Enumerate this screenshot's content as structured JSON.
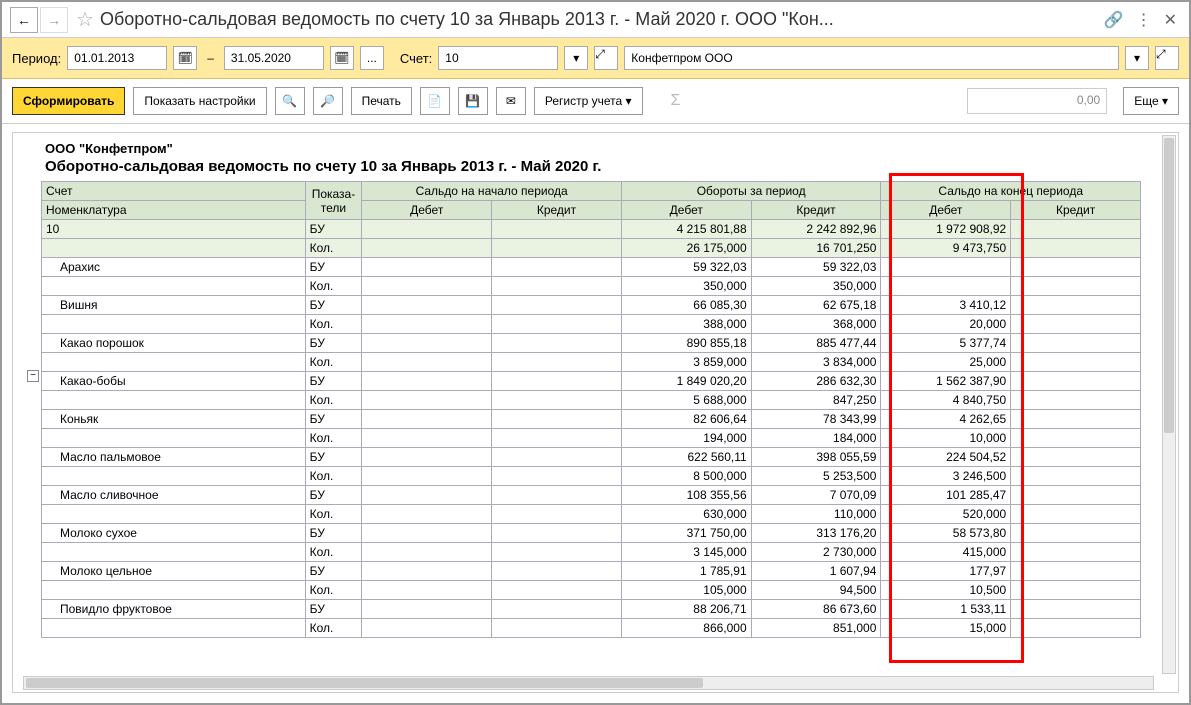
{
  "title": "Оборотно-сальдовая ведомость по счету 10 за Январь 2013 г. - Май 2020 г. ООО \"Кон...",
  "period_label": "Период:",
  "date_from": "01.01.2013",
  "date_to": "31.05.2020",
  "dots": "...",
  "account_label": "Счет:",
  "account_value": "10",
  "org_value": "Конфетпром ООО",
  "btn_form": "Сформировать",
  "btn_settings": "Показать настройки",
  "btn_print": "Печать",
  "btn_register": "Регистр учета ▾",
  "btn_more": "Еще ▾",
  "sum_value": "0,00",
  "company": "ООО \"Конфетпром\"",
  "report_title": "Оборотно-сальдовая ведомость по счету 10 за Январь 2013 г. - Май 2020 г.",
  "hdr_account": "Счет",
  "hdr_indicators": "Показа-тели",
  "hdr_nomen": "Номенклатура",
  "hdr_open": "Сальдо на начало периода",
  "hdr_turn": "Обороты за период",
  "hdr_close": "Сальдо на конец периода",
  "hdr_debit": "Дебет",
  "hdr_credit": "Кредит",
  "ind_bu": "БУ",
  "ind_kol": "Кол.",
  "total": {
    "label": "10",
    "bu": {
      "td": "4 215 801,88",
      "tc": "2 242 892,96",
      "cd": "1 972 908,92"
    },
    "kol": {
      "td": "26 175,000",
      "tc": "16 701,250",
      "cd": "9 473,750"
    }
  },
  "rows": [
    {
      "name": "Арахис",
      "bu": {
        "td": "59 322,03",
        "tc": "59 322,03",
        "cd": ""
      },
      "kol": {
        "td": "350,000",
        "tc": "350,000",
        "cd": ""
      }
    },
    {
      "name": "Вишня",
      "bu": {
        "td": "66 085,30",
        "tc": "62 675,18",
        "cd": "3 410,12"
      },
      "kol": {
        "td": "388,000",
        "tc": "368,000",
        "cd": "20,000"
      }
    },
    {
      "name": "Какао порошок",
      "bu": {
        "td": "890 855,18",
        "tc": "885 477,44",
        "cd": "5 377,74"
      },
      "kol": {
        "td": "3 859,000",
        "tc": "3 834,000",
        "cd": "25,000"
      }
    },
    {
      "name": "Какао-бобы",
      "bu": {
        "td": "1 849 020,20",
        "tc": "286 632,30",
        "cd": "1 562 387,90"
      },
      "kol": {
        "td": "5 688,000",
        "tc": "847,250",
        "cd": "4 840,750"
      }
    },
    {
      "name": "Коньяк",
      "bu": {
        "td": "82 606,64",
        "tc": "78 343,99",
        "cd": "4 262,65"
      },
      "kol": {
        "td": "194,000",
        "tc": "184,000",
        "cd": "10,000"
      }
    },
    {
      "name": "Масло пальмовое",
      "bu": {
        "td": "622 560,11",
        "tc": "398 055,59",
        "cd": "224 504,52"
      },
      "kol": {
        "td": "8 500,000",
        "tc": "5 253,500",
        "cd": "3 246,500"
      }
    },
    {
      "name": "Масло сливочное",
      "bu": {
        "td": "108 355,56",
        "tc": "7 070,09",
        "cd": "101 285,47"
      },
      "kol": {
        "td": "630,000",
        "tc": "110,000",
        "cd": "520,000"
      }
    },
    {
      "name": "Молоко сухое",
      "bu": {
        "td": "371 750,00",
        "tc": "313 176,20",
        "cd": "58 573,80"
      },
      "kol": {
        "td": "3 145,000",
        "tc": "2 730,000",
        "cd": "415,000"
      }
    },
    {
      "name": "Молоко цельное",
      "bu": {
        "td": "1 785,91",
        "tc": "1 607,94",
        "cd": "177,97"
      },
      "kol": {
        "td": "105,000",
        "tc": "94,500",
        "cd": "10,500"
      }
    },
    {
      "name": "Повидло фруктовое",
      "bu": {
        "td": "88 206,71",
        "tc": "86 673,60",
        "cd": "1 533,11"
      },
      "kol": {
        "td": "866,000",
        "tc": "851,000",
        "cd": "15,000"
      }
    }
  ]
}
